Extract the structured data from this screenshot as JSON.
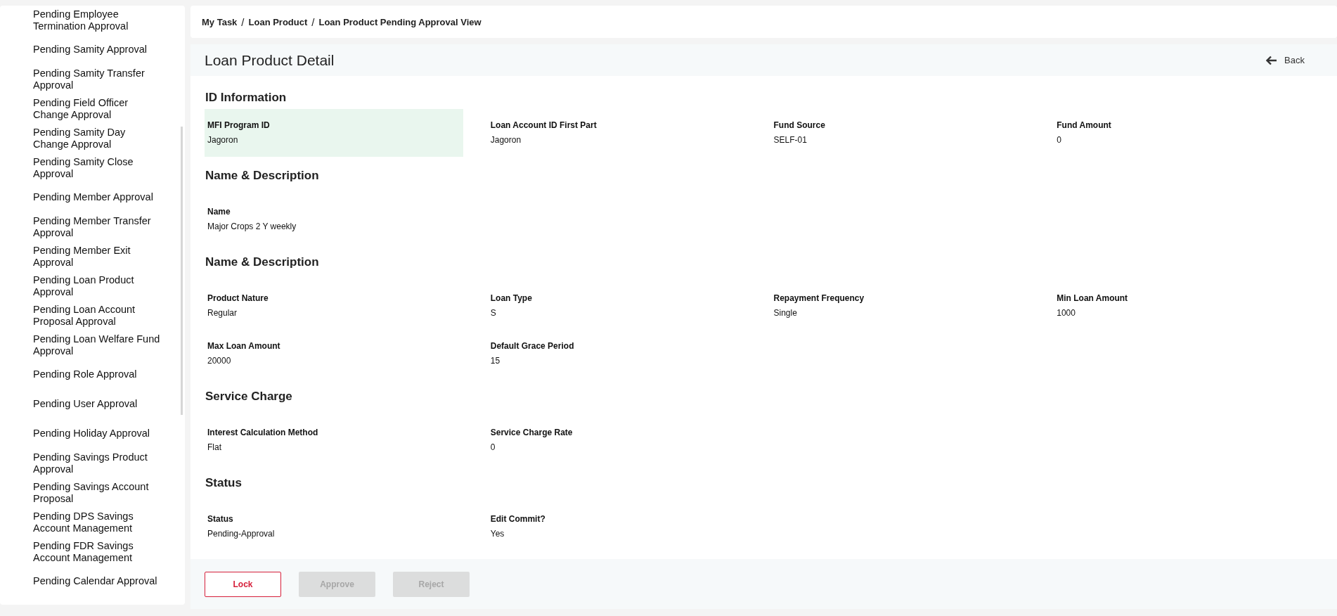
{
  "sidebar": {
    "items": [
      {
        "label": "Pending Employee Termination Approval"
      },
      {
        "label": "Pending Samity Approval"
      },
      {
        "label": "Pending Samity Transfer Approval"
      },
      {
        "label": "Pending Field Officer Change Approval"
      },
      {
        "label": "Pending Samity Day Change Approval"
      },
      {
        "label": "Pending Samity Close Approval"
      },
      {
        "label": "Pending Member Approval"
      },
      {
        "label": "Pending Member Transfer Approval"
      },
      {
        "label": "Pending Member Exit Approval"
      },
      {
        "label": "Pending Loan Product Approval"
      },
      {
        "label": "Pending Loan Account Proposal Approval"
      },
      {
        "label": "Pending Loan Welfare Fund Approval"
      },
      {
        "label": "Pending Role Approval"
      },
      {
        "label": "Pending User Approval"
      },
      {
        "label": "Pending Holiday Approval"
      },
      {
        "label": "Pending Savings Product Approval"
      },
      {
        "label": "Pending Savings Account Proposal"
      },
      {
        "label": "Pending DPS Savings Account Management"
      },
      {
        "label": "Pending FDR Savings Account Management"
      },
      {
        "label": "Pending Calendar Approval"
      }
    ]
  },
  "breadcrumb": [
    "My Task",
    "Loan Product",
    "Loan Product Pending Approval View"
  ],
  "breadcrumb_separators": [
    "/",
    "/"
  ],
  "page": {
    "title": "Loan Product Detail",
    "back": "Back"
  },
  "sections": [
    {
      "title": "ID Information",
      "fields": [
        {
          "label": "MFI Program ID",
          "value": "Jagoron",
          "hovered": true
        },
        {
          "label": "Loan Account ID First Part",
          "value": "Jagoron",
          "hovered": false
        },
        {
          "label": "Fund Source",
          "value": "SELF-01",
          "hovered": false
        },
        {
          "label": "Fund Amount",
          "value": "0",
          "hovered": false
        }
      ]
    },
    {
      "title": "Name & Description",
      "fields": [
        {
          "label": "Name",
          "value": "Major Crops 2 Y weekly",
          "hovered": false
        }
      ]
    },
    {
      "title": "Name & Description",
      "fields": [
        {
          "label": "Product Nature",
          "value": "Regular",
          "hovered": false
        },
        {
          "label": "Loan Type",
          "value": "S",
          "hovered": false
        },
        {
          "label": "Repayment Frequency",
          "value": "Single",
          "hovered": false
        },
        {
          "label": "Min Loan Amount",
          "value": "1000",
          "hovered": false
        },
        {
          "label": "Max Loan Amount",
          "value": "20000",
          "hovered": false
        },
        {
          "label": "Default Grace Period",
          "value": "15",
          "hovered": false
        }
      ]
    },
    {
      "title": "Service Charge",
      "fields": [
        {
          "label": "Interest Calculation Method",
          "value": "Flat",
          "hovered": false
        },
        {
          "label": "Service Charge Rate",
          "value": "0",
          "hovered": false
        }
      ]
    },
    {
      "title": "Status",
      "fields": [
        {
          "label": "Status",
          "value": "Pending-Approval",
          "hovered": false
        },
        {
          "label": "Edit Commit?",
          "value": "Yes",
          "hovered": false
        }
      ]
    }
  ],
  "buttons": [
    {
      "label": "Lock",
      "kind": "outline",
      "disabled": false
    },
    {
      "label": "Approve",
      "kind": "solid",
      "disabled": true
    },
    {
      "label": "Reject",
      "kind": "solid",
      "disabled": true
    }
  ]
}
